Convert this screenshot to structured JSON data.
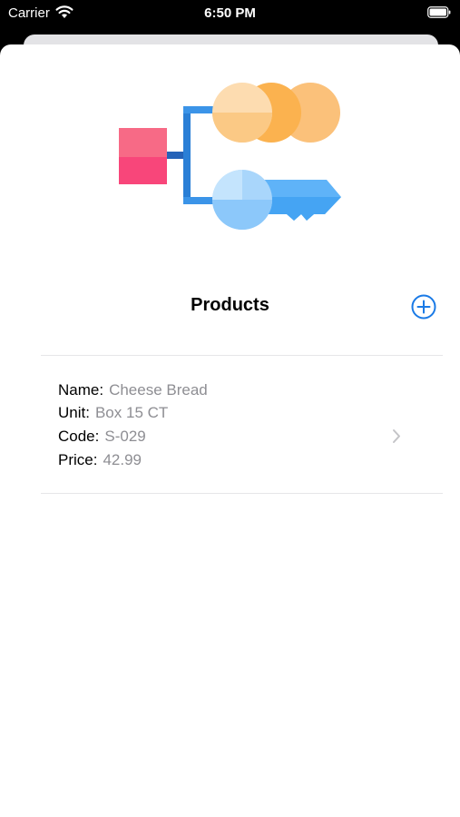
{
  "status_bar": {
    "carrier": "Carrier",
    "time": "6:50 PM",
    "wifi_icon": "wifi-icon",
    "battery_icon": "battery-icon"
  },
  "header": {
    "title": "Products",
    "add_icon": "plus-circle-icon",
    "accent_color": "#1a7ae6"
  },
  "illustration_icon": "key-hierarchy-illustration",
  "products": [
    {
      "fields": [
        {
          "label": "Name:",
          "value": "Cheese Bread"
        },
        {
          "label": "Unit:",
          "value": "Box 15 CT"
        },
        {
          "label": "Code:",
          "value": "S-029"
        },
        {
          "label": "Price:",
          "value": "42.99"
        }
      ],
      "chevron_icon": "chevron-right-icon"
    }
  ]
}
